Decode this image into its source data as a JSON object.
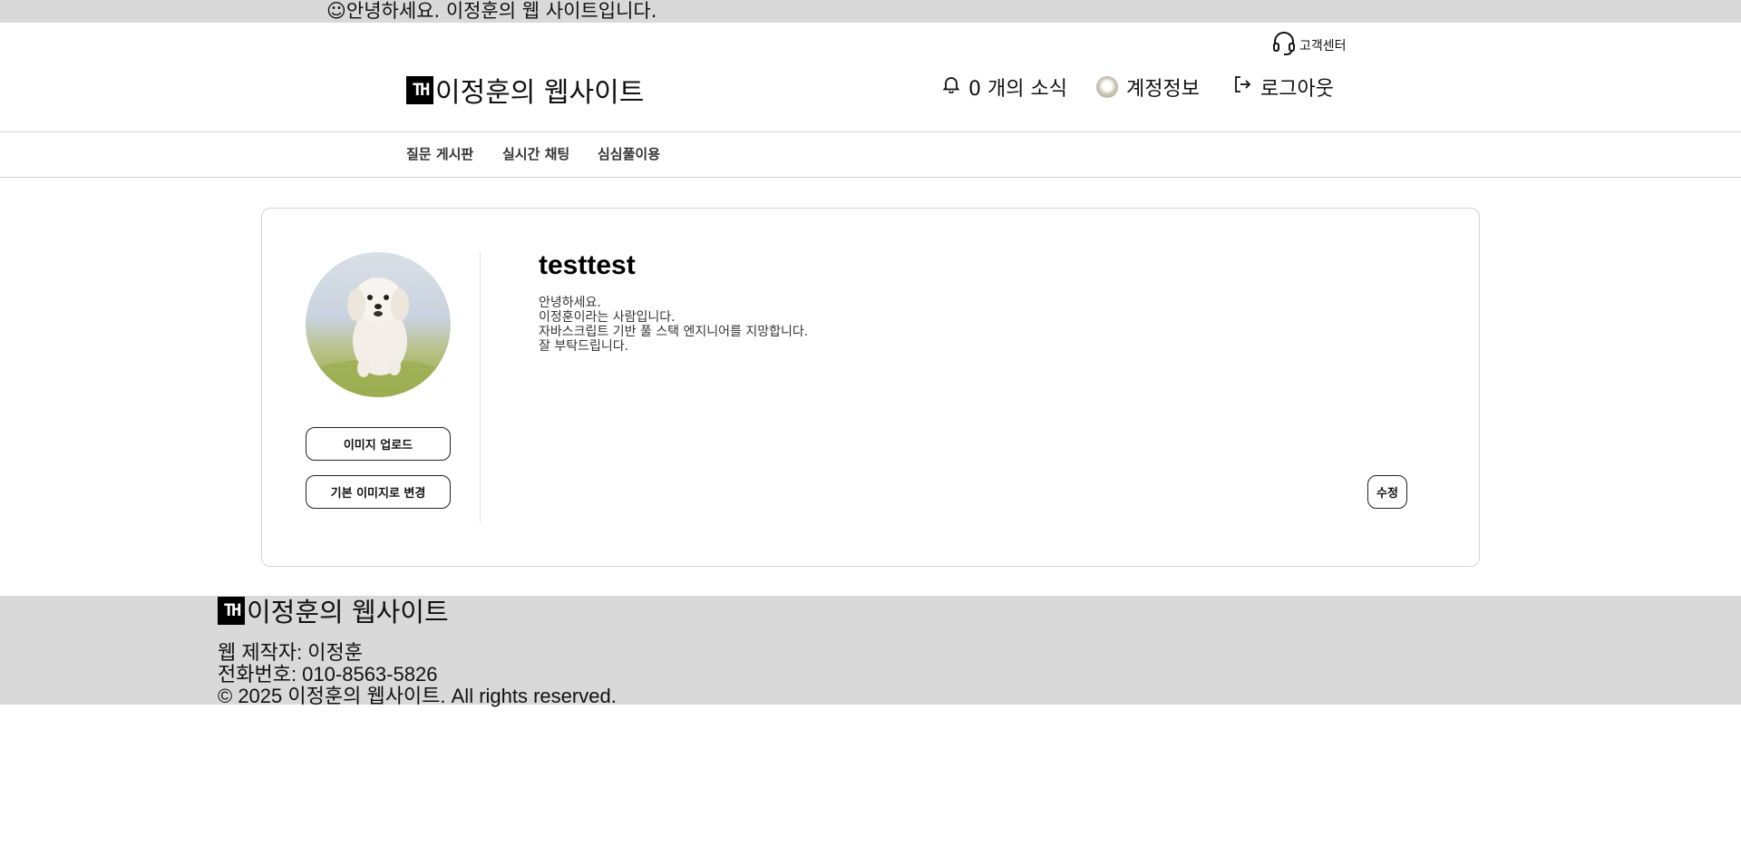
{
  "topbar": {
    "message": "☺안녕하세요. 이정훈의 웹 사이트입니다."
  },
  "header": {
    "support_label": "고객센터",
    "logo_mark": "TH",
    "logo_text": "이정훈의 웹사이트",
    "notification_label": "0 개의 소식",
    "account_label": "계정정보",
    "logout_label": "로그아웃"
  },
  "nav": {
    "items": [
      "질문 게시판",
      "실시간 채팅",
      "심심풀이용"
    ]
  },
  "profile": {
    "username": "testtest",
    "bio": [
      "안녕하세요.",
      "이정훈이라는 사람입니다.",
      "자바스크립트 기반 풀 스택 엔지니어를 지망합니다.",
      "잘 부탁드립니다."
    ],
    "upload_button": "이미지 업로드",
    "default_button": "기본 이미지로 변경",
    "edit_button": "수정"
  },
  "footer": {
    "logo_mark": "TH",
    "logo_text": "이정훈의 웹사이트",
    "lines": [
      "웹 제작자: 이정훈",
      "전화번호: 010-8563-5826",
      "© 2025 이정훈의 웹사이트. All rights reserved."
    ]
  },
  "icons": {
    "support": "headset-icon",
    "notification": "bell-icon",
    "account": "avatar-icon",
    "logout": "logout-icon"
  }
}
